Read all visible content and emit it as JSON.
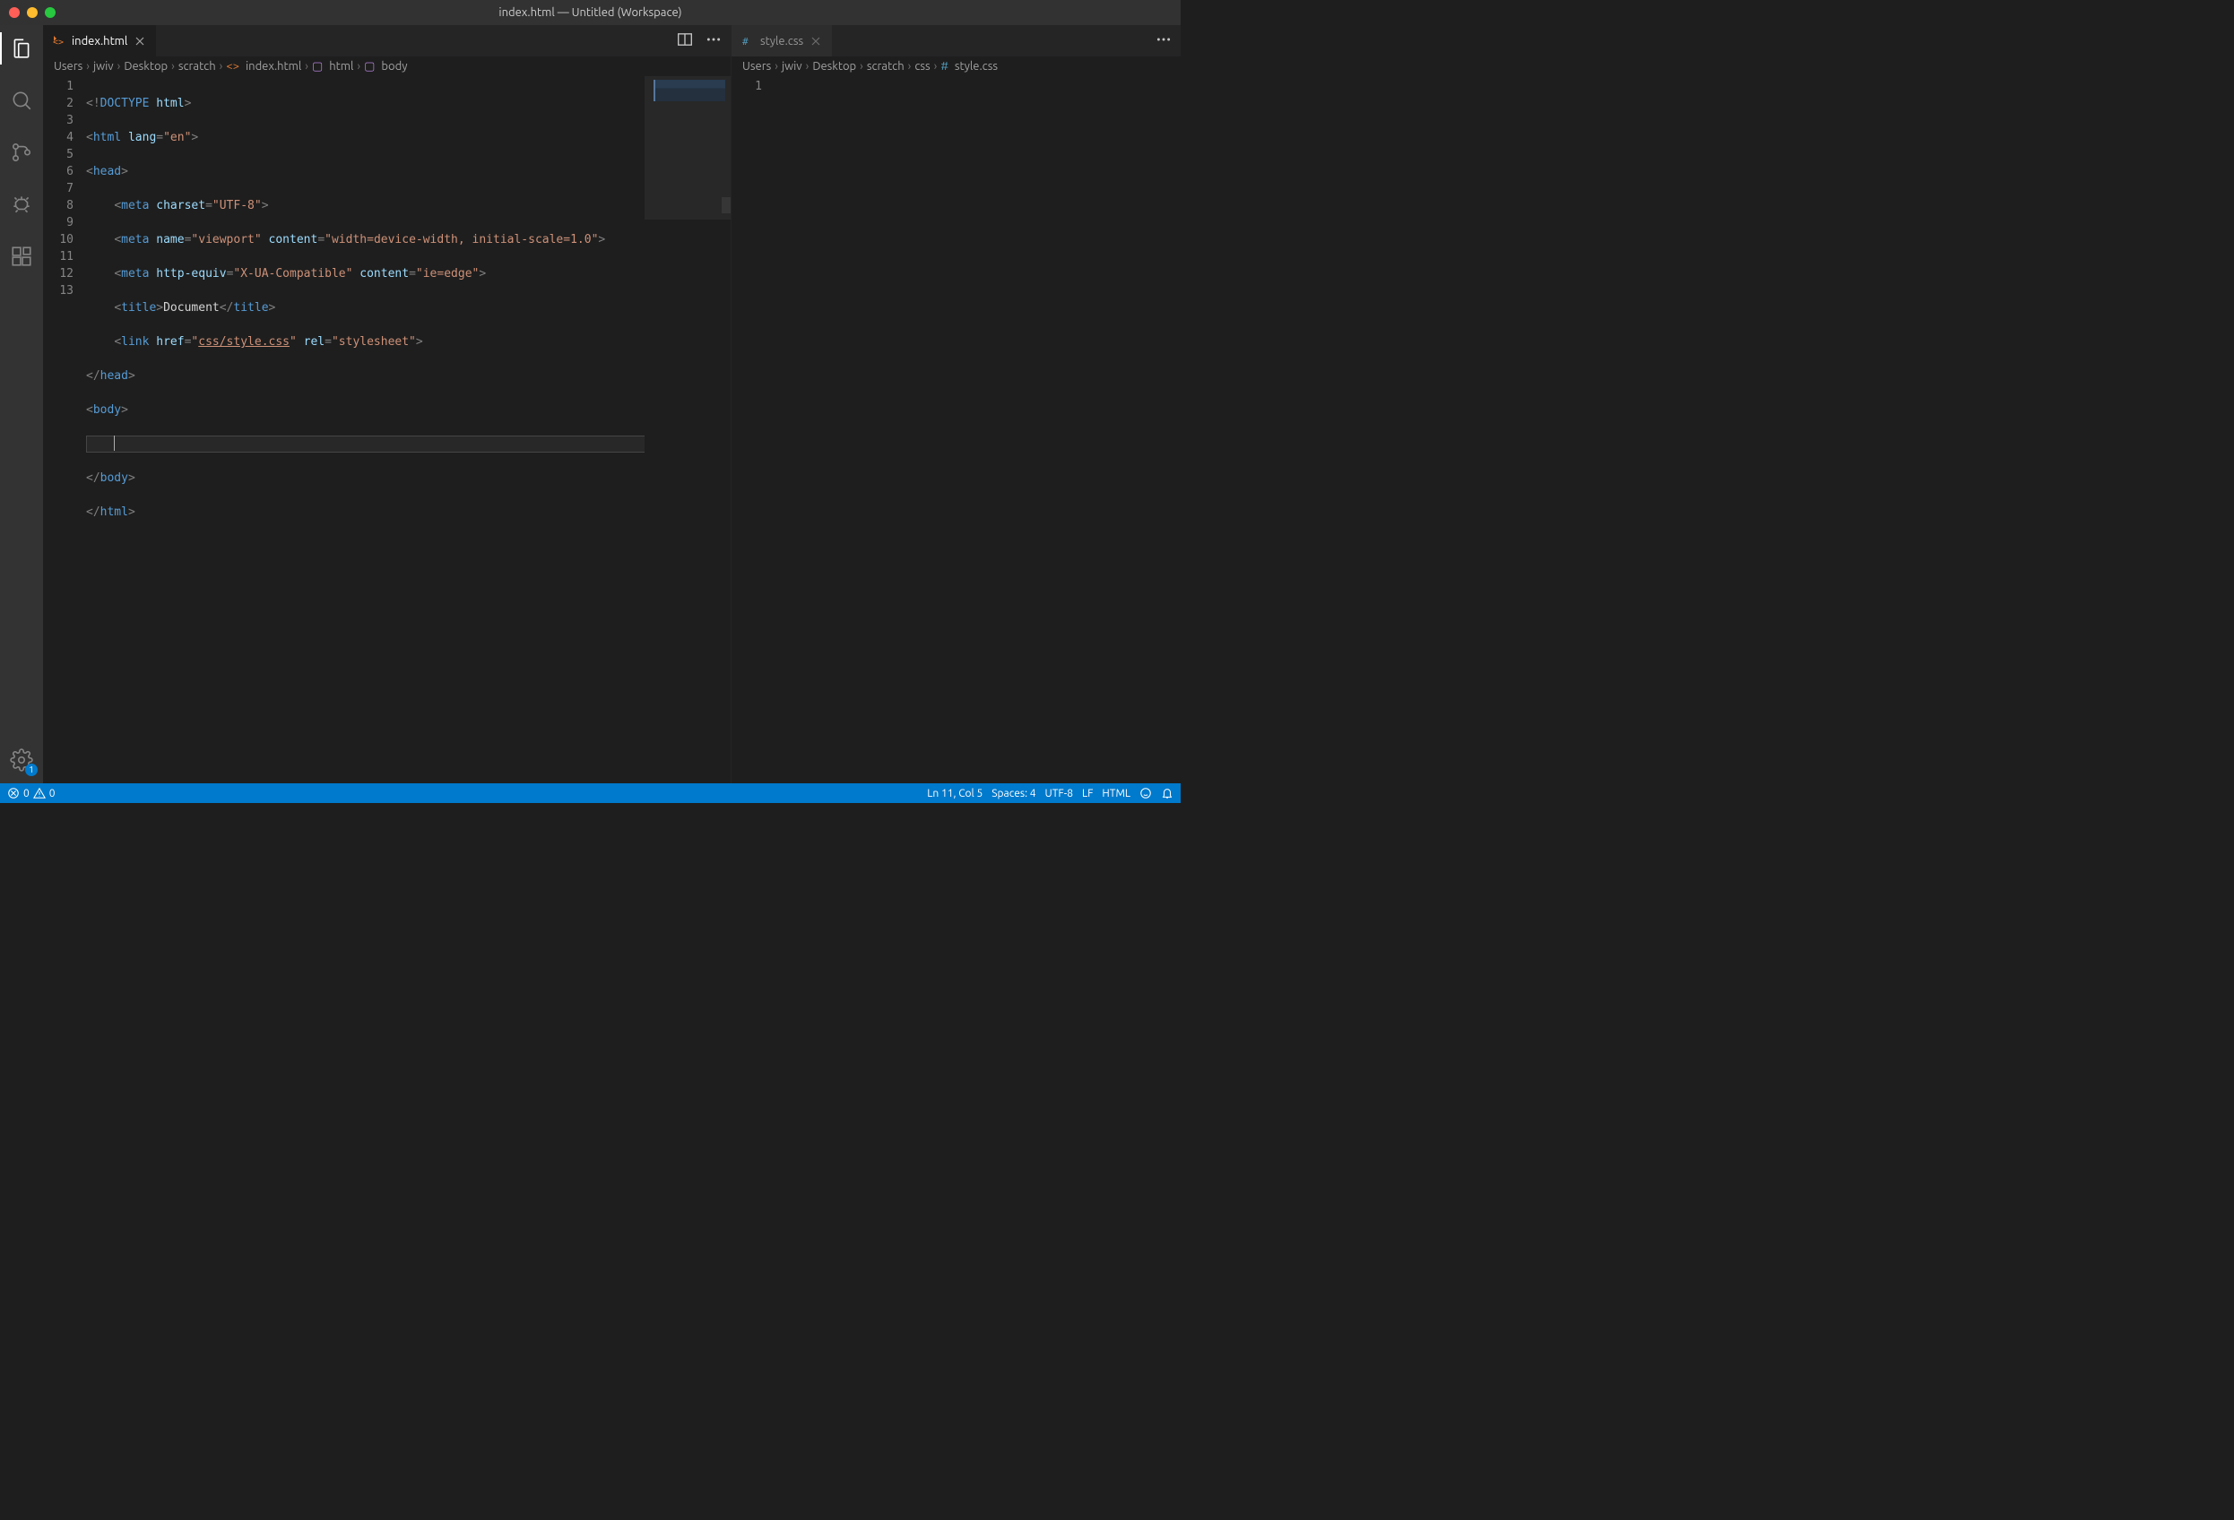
{
  "window_title": "index.html — Untitled (Workspace)",
  "activity_bar": {
    "items": [
      "explorer",
      "search",
      "source-control",
      "debug",
      "extensions"
    ],
    "settings_badge": "1"
  },
  "left_editor": {
    "tab_label": "index.html",
    "breadcrumbs": [
      "Users",
      "jwiv",
      "Desktop",
      "scratch",
      "index.html",
      "html",
      "body"
    ],
    "lines": [
      "1",
      "2",
      "3",
      "4",
      "5",
      "6",
      "7",
      "8",
      "9",
      "10",
      "11",
      "12",
      "13"
    ]
  },
  "right_editor": {
    "tab_label": "style.css",
    "breadcrumbs": [
      "Users",
      "jwiv",
      "Desktop",
      "scratch",
      "css",
      "style.css"
    ],
    "lines": [
      "1"
    ]
  },
  "code": {
    "title_text": "Document",
    "link_href": "css/style.css"
  },
  "statusbar": {
    "errors": "0",
    "warnings": "0",
    "cursor": "Ln 11, Col 5",
    "spaces": "Spaces: 4",
    "encoding": "UTF-8",
    "eol": "LF",
    "lang": "HTML"
  }
}
